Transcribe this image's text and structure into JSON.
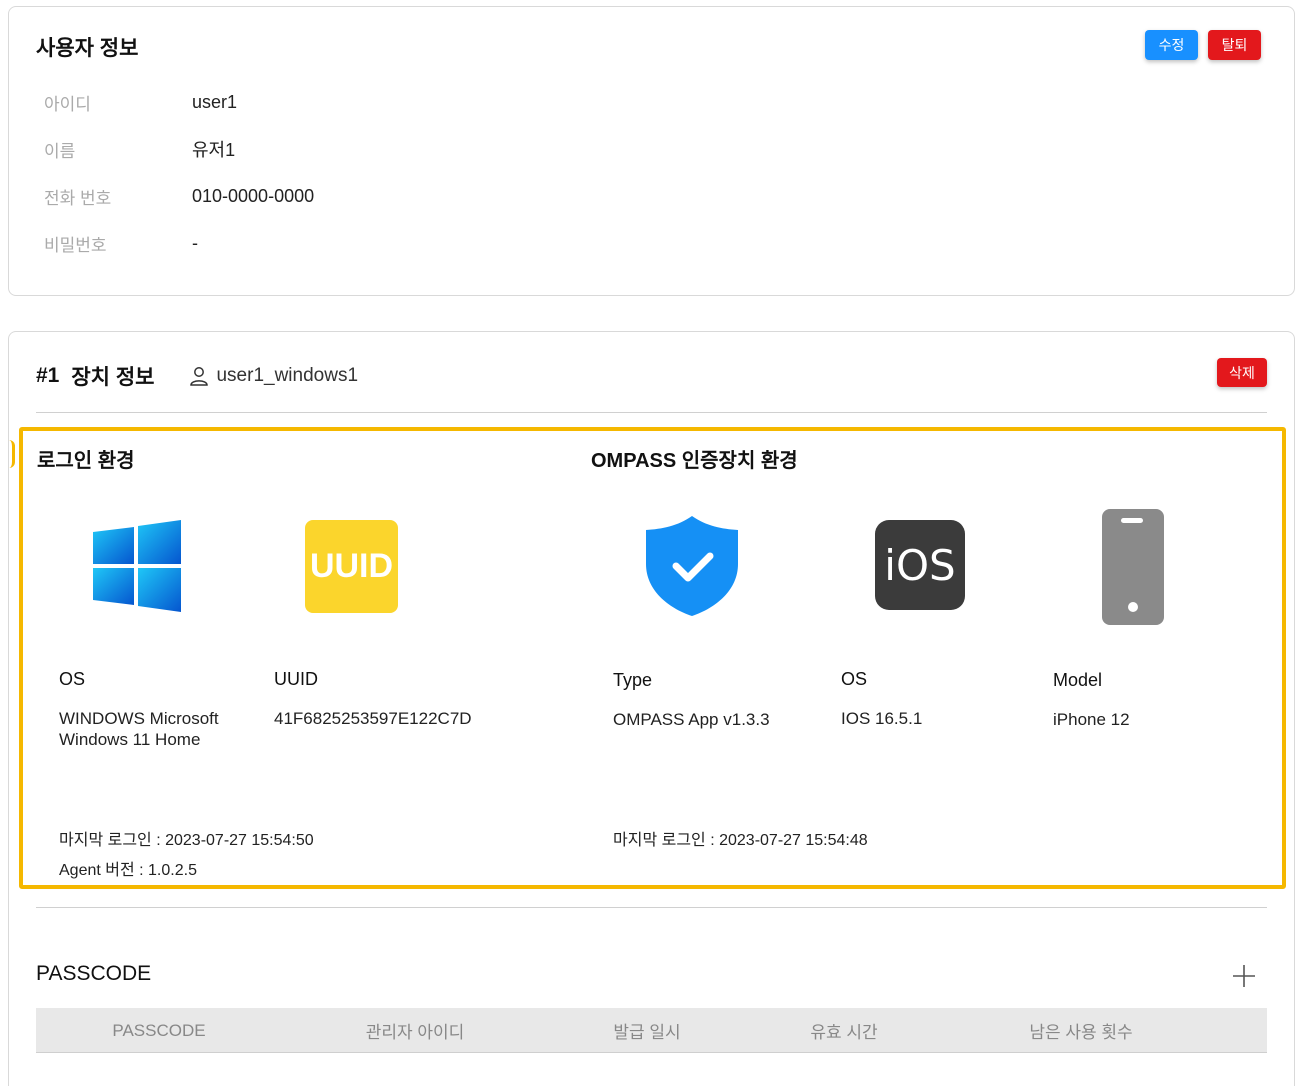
{
  "user_info": {
    "title": "사용자 정보",
    "edit_label": "수정",
    "withdraw_label": "탈퇴",
    "rows": [
      {
        "label": "아이디",
        "value": "user1"
      },
      {
        "label": "이름",
        "value": "유저1"
      },
      {
        "label": "전화 번호",
        "value": "010-0000-0000"
      },
      {
        "label": "비밀번호",
        "value": "-"
      }
    ]
  },
  "device": {
    "number": "#1",
    "title": "장치 정보",
    "user_name": "user1_windows1",
    "delete_label": "삭제",
    "login_env": {
      "title": "로그인 환경",
      "icons": [
        "windows-logo-icon",
        "uuid-icon"
      ],
      "os_label": "OS",
      "os_value": "WINDOWS Microsoft Windows 11 Home",
      "uuid_label": "UUID",
      "uuid_badge": "UUID",
      "uuid_value": "41F6825253597E122C7D",
      "last_login": "마지막 로그인 : 2023-07-27 15:54:50",
      "agent_version": "Agent 버전 : 1.0.2.5"
    },
    "auth_env": {
      "title": "OMPASS 인증장치 환경",
      "icons": [
        "shield-check-icon",
        "ios-icon",
        "smartphone-icon"
      ],
      "type_label": "Type",
      "type_value": "OMPASS App v1.3.3",
      "os_label": "OS",
      "os_badge": "iOS",
      "os_value": "IOS 16.5.1",
      "model_label": "Model",
      "model_value": "iPhone 12",
      "last_login": "마지막 로그인 : 2023-07-27 15:54:48"
    },
    "highlight_color": "#f5b800"
  },
  "passcode": {
    "title": "PASSCODE",
    "add_icon": "plus-icon",
    "columns": [
      "PASSCODE",
      "관리자 아이디",
      "발급 일시",
      "유효 시간",
      "남은 사용 횟수"
    ]
  },
  "colors": {
    "primary": "#1890ff",
    "danger": "#e3181c",
    "highlight": "#f5b800",
    "windows": "#0a7fe0",
    "uuid": "#fbd52c",
    "shield": "#1590f5",
    "ios_bg": "#3b3b3b",
    "phone": "#8a8a8a"
  }
}
